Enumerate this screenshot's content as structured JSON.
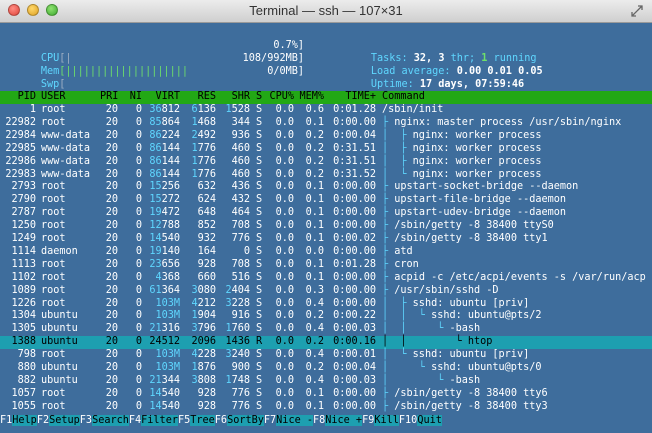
{
  "window": {
    "title": "Terminal — ssh — 107×31"
  },
  "meters": {
    "cpu": {
      "label": "CPU",
      "bar": "[|",
      "value": "0.7%]"
    },
    "mem": {
      "label": "Mem",
      "bar": "[||||||||||||||||||||",
      "value": "108/992MB]"
    },
    "swp": {
      "label": "Swp",
      "bar": "[",
      "value": "0/0MB]"
    }
  },
  "summary": {
    "tasks_label": "Tasks:",
    "tasks": "32,",
    "thr": "3",
    "thr_label": "thr;",
    "running": "1",
    "running_label": "running",
    "load_label": "Load average:",
    "load1": "0.00",
    "load5": "0.01",
    "load15": "0.05",
    "uptime_label": "Uptime:",
    "uptime": "17 days, 07:59:46"
  },
  "columns": [
    "PID",
    "USER",
    "PRI",
    "NI",
    "VIRT",
    "RES",
    "SHR",
    "S",
    "CPU%",
    "MEM%",
    "TIME+",
    "Command"
  ],
  "rows": [
    {
      "pid": "1",
      "user": "root",
      "pri": "20",
      "ni": "0",
      "virt": "36812",
      "res": "6136",
      "shr": "1528",
      "s": "S",
      "cpu": "0.0",
      "mem": "0.6",
      "time": "0:01.28",
      "cmd": "/sbin/init",
      "tree": ""
    },
    {
      "pid": "22982",
      "user": "root",
      "pri": "20",
      "ni": "0",
      "virt": "85864",
      "res": "1468",
      "shr": "344",
      "s": "S",
      "cpu": "0.0",
      "mem": "0.1",
      "time": "0:00.00",
      "cmd": "nginx: master process /usr/sbin/nginx",
      "tree": "├ "
    },
    {
      "pid": "22984",
      "user": "www-data",
      "pri": "20",
      "ni": "0",
      "virt": "86224",
      "res": "2492",
      "shr": "936",
      "s": "S",
      "cpu": "0.0",
      "mem": "0.2",
      "time": "0:00.04",
      "cmd": "nginx: worker process",
      "tree": "│  ├ "
    },
    {
      "pid": "22985",
      "user": "www-data",
      "pri": "20",
      "ni": "0",
      "virt": "86144",
      "res": "1776",
      "shr": "460",
      "s": "S",
      "cpu": "0.0",
      "mem": "0.2",
      "time": "0:31.51",
      "cmd": "nginx: worker process",
      "tree": "│  ├ "
    },
    {
      "pid": "22986",
      "user": "www-data",
      "pri": "20",
      "ni": "0",
      "virt": "86144",
      "res": "1776",
      "shr": "460",
      "s": "S",
      "cpu": "0.0",
      "mem": "0.2",
      "time": "0:31.51",
      "cmd": "nginx: worker process",
      "tree": "│  ├ "
    },
    {
      "pid": "22983",
      "user": "www-data",
      "pri": "20",
      "ni": "0",
      "virt": "86144",
      "res": "1776",
      "shr": "460",
      "s": "S",
      "cpu": "0.0",
      "mem": "0.2",
      "time": "0:31.52",
      "cmd": "nginx: worker process",
      "tree": "│  └ "
    },
    {
      "pid": "2793",
      "user": "root",
      "pri": "20",
      "ni": "0",
      "virt": "15256",
      "res": "632",
      "shr": "436",
      "s": "S",
      "cpu": "0.0",
      "mem": "0.1",
      "time": "0:00.00",
      "cmd": "upstart-socket-bridge --daemon",
      "tree": "├ "
    },
    {
      "pid": "2790",
      "user": "root",
      "pri": "20",
      "ni": "0",
      "virt": "15272",
      "res": "624",
      "shr": "432",
      "s": "S",
      "cpu": "0.0",
      "mem": "0.1",
      "time": "0:00.00",
      "cmd": "upstart-file-bridge --daemon",
      "tree": "├ "
    },
    {
      "pid": "2787",
      "user": "root",
      "pri": "20",
      "ni": "0",
      "virt": "19472",
      "res": "648",
      "shr": "464",
      "s": "S",
      "cpu": "0.0",
      "mem": "0.1",
      "time": "0:00.00",
      "cmd": "upstart-udev-bridge --daemon",
      "tree": "├ "
    },
    {
      "pid": "1250",
      "user": "root",
      "pri": "20",
      "ni": "0",
      "virt": "12788",
      "res": "852",
      "shr": "708",
      "s": "S",
      "cpu": "0.0",
      "mem": "0.1",
      "time": "0:00.00",
      "cmd": "/sbin/getty -8 38400 ttyS0",
      "tree": "├ "
    },
    {
      "pid": "1249",
      "user": "root",
      "pri": "20",
      "ni": "0",
      "virt": "14540",
      "res": "932",
      "shr": "776",
      "s": "S",
      "cpu": "0.0",
      "mem": "0.1",
      "time": "0:00.02",
      "cmd": "/sbin/getty -8 38400 tty1",
      "tree": "├ "
    },
    {
      "pid": "1114",
      "user": "daemon",
      "pri": "20",
      "ni": "0",
      "virt": "19140",
      "res": "164",
      "shr": "0",
      "s": "S",
      "cpu": "0.0",
      "mem": "0.0",
      "time": "0:00.00",
      "cmd": "atd",
      "tree": "├ "
    },
    {
      "pid": "1113",
      "user": "root",
      "pri": "20",
      "ni": "0",
      "virt": "23656",
      "res": "928",
      "shr": "708",
      "s": "S",
      "cpu": "0.0",
      "mem": "0.1",
      "time": "0:01.28",
      "cmd": "cron",
      "tree": "├ "
    },
    {
      "pid": "1102",
      "user": "root",
      "pri": "20",
      "ni": "0",
      "virt": "4368",
      "res": "660",
      "shr": "516",
      "s": "S",
      "cpu": "0.0",
      "mem": "0.1",
      "time": "0:00.00",
      "cmd": "acpid -c /etc/acpi/events -s /var/run/acp",
      "tree": "├ "
    },
    {
      "pid": "1089",
      "user": "root",
      "pri": "20",
      "ni": "0",
      "virt": "61364",
      "res": "3080",
      "shr": "2404",
      "s": "S",
      "cpu": "0.0",
      "mem": "0.3",
      "time": "0:00.00",
      "cmd": "/usr/sbin/sshd -D",
      "tree": "├ "
    },
    {
      "pid": "1226",
      "user": "root",
      "pri": "20",
      "ni": "0",
      "virt": "103M",
      "res": "4212",
      "shr": "3228",
      "s": "S",
      "cpu": "0.0",
      "mem": "0.4",
      "time": "0:00.00",
      "cmd": "sshd: ubuntu [priv]",
      "tree": "│  ├ "
    },
    {
      "pid": "1304",
      "user": "ubuntu",
      "pri": "20",
      "ni": "0",
      "virt": "103M",
      "res": "1904",
      "shr": "916",
      "s": "S",
      "cpu": "0.0",
      "mem": "0.2",
      "time": "0:00.22",
      "cmd": "sshd: ubuntu@pts/2",
      "tree": "│  │  └ "
    },
    {
      "pid": "1305",
      "user": "ubuntu",
      "pri": "20",
      "ni": "0",
      "virt": "21316",
      "res": "3796",
      "shr": "1760",
      "s": "S",
      "cpu": "0.0",
      "mem": "0.4",
      "time": "0:00.03",
      "cmd": "-bash",
      "tree": "│  │     └ "
    },
    {
      "pid": "1388",
      "user": "ubuntu",
      "pri": "20",
      "ni": "0",
      "virt": "24512",
      "res": "2096",
      "shr": "1436",
      "s": "R",
      "cpu": "0.0",
      "mem": "0.2",
      "time": "0:00.16",
      "cmd": "htop",
      "tree": "│  │        └ ",
      "selected": true
    },
    {
      "pid": "798",
      "user": "root",
      "pri": "20",
      "ni": "0",
      "virt": "103M",
      "res": "4228",
      "shr": "3240",
      "s": "S",
      "cpu": "0.0",
      "mem": "0.4",
      "time": "0:00.01",
      "cmd": "sshd: ubuntu [priv]",
      "tree": "│  └ "
    },
    {
      "pid": "880",
      "user": "ubuntu",
      "pri": "20",
      "ni": "0",
      "virt": "103M",
      "res": "1876",
      "shr": "900",
      "s": "S",
      "cpu": "0.0",
      "mem": "0.2",
      "time": "0:00.04",
      "cmd": "sshd: ubuntu@pts/0",
      "tree": "│     └ "
    },
    {
      "pid": "882",
      "user": "ubuntu",
      "pri": "20",
      "ni": "0",
      "virt": "21344",
      "res": "3808",
      "shr": "1748",
      "s": "S",
      "cpu": "0.0",
      "mem": "0.4",
      "time": "0:00.03",
      "cmd": "-bash",
      "tree": "│        └ "
    },
    {
      "pid": "1057",
      "user": "root",
      "pri": "20",
      "ni": "0",
      "virt": "14540",
      "res": "928",
      "shr": "776",
      "s": "S",
      "cpu": "0.0",
      "mem": "0.1",
      "time": "0:00.00",
      "cmd": "/sbin/getty -8 38400 tty6",
      "tree": "├ "
    },
    {
      "pid": "1055",
      "user": "root",
      "pri": "20",
      "ni": "0",
      "virt": "14540",
      "res": "928",
      "shr": "776",
      "s": "S",
      "cpu": "0.0",
      "mem": "0.1",
      "time": "0:00.00",
      "cmd": "/sbin/getty -8 38400 tty3",
      "tree": "├ "
    }
  ],
  "footer": [
    {
      "key": "F1",
      "label": "Help"
    },
    {
      "key": "F2",
      "label": "Setup"
    },
    {
      "key": "F3",
      "label": "Search"
    },
    {
      "key": "F4",
      "label": "Filter"
    },
    {
      "key": "F5",
      "label": "Tree"
    },
    {
      "key": "F6",
      "label": "SortBy"
    },
    {
      "key": "F7",
      "label": "Nice -"
    },
    {
      "key": "F8",
      "label": "Nice +"
    },
    {
      "key": "F9",
      "label": "Kill"
    },
    {
      "key": "F10",
      "label": "Quit"
    }
  ],
  "colors": {
    "background": "#3e6d9c",
    "header": "#22a815",
    "selection": "#1d9fb0",
    "accent": "#5fd7ff"
  }
}
